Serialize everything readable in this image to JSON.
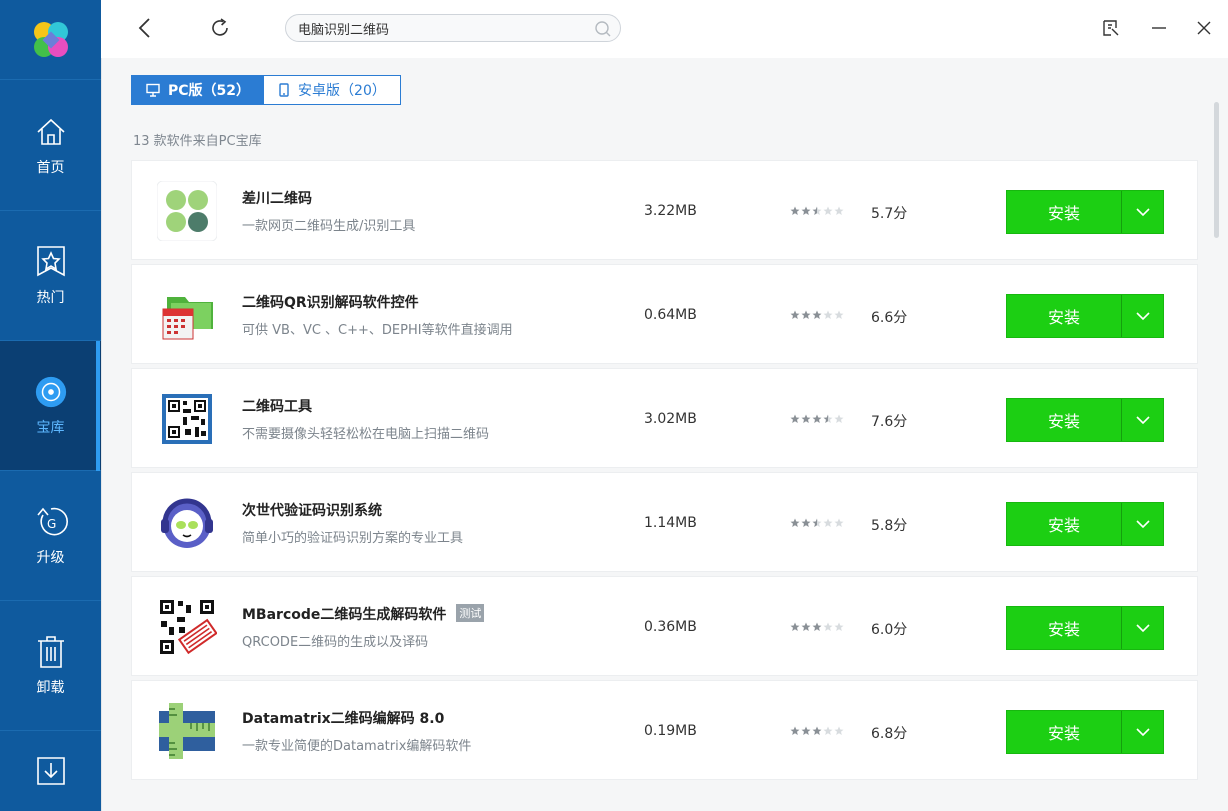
{
  "search": {
    "value": "电脑识别二维码"
  },
  "sidebar": {
    "items": [
      {
        "label": "首页",
        "icon": "home-icon"
      },
      {
        "label": "热门",
        "icon": "star-icon"
      },
      {
        "label": "宝库",
        "icon": "disc-icon",
        "active": true
      },
      {
        "label": "升级",
        "icon": "upgrade-icon"
      },
      {
        "label": "卸载",
        "icon": "trash-icon"
      },
      {
        "label": "",
        "icon": "download-icon"
      }
    ]
  },
  "tabs": [
    {
      "label": "PC版（52）",
      "icon": "monitor-icon",
      "active": true
    },
    {
      "label": "安卓版（20）",
      "icon": "phone-icon",
      "active": false
    }
  ],
  "source_note": "13 款软件来自PC宝库",
  "apps": [
    {
      "name": "差川二维码",
      "desc": "一款网页二维码生成/识别工具",
      "size": "3.22MB",
      "rating": 2.5,
      "score": "5.7分",
      "install": "安装",
      "icon": "dots-icon"
    },
    {
      "name": "二维码QR识别解码软件控件",
      "desc": "可供 VB、VC 、C++、DEPHI等软件直接调用",
      "size": "0.64MB",
      "rating": 3,
      "score": "6.6分",
      "install": "安装",
      "icon": "folder-calendar-icon"
    },
    {
      "name": "二维码工具",
      "desc": "不需要摄像头轻轻松松在电脑上扫描二维码",
      "size": "3.02MB",
      "rating": 3.5,
      "score": "7.6分",
      "install": "安装",
      "icon": "qr-icon"
    },
    {
      "name": "次世代验证码识别系统",
      "desc": "简单小巧的验证码识别方案的专业工具",
      "size": "1.14MB",
      "rating": 2.5,
      "score": "5.8分",
      "install": "安装",
      "icon": "napster-icon"
    },
    {
      "name": "MBarcode二维码生成解码软件",
      "badge": "测试",
      "desc": "QRCODE二维码的生成以及译码",
      "size": "0.36MB",
      "rating": 3,
      "score": "6.0分",
      "install": "安装",
      "icon": "qr-stamp-icon"
    },
    {
      "name": "Datamatrix二维码编解码 8.0",
      "desc": "一款专业简便的Datamatrix编解码软件",
      "size": "0.19MB",
      "rating": 3,
      "score": "6.8分",
      "install": "安装",
      "icon": "ruler-icon"
    }
  ],
  "colors": {
    "sidebar": "#0f5a9e",
    "accent": "#2b7cd3",
    "install": "#1ccf13"
  }
}
